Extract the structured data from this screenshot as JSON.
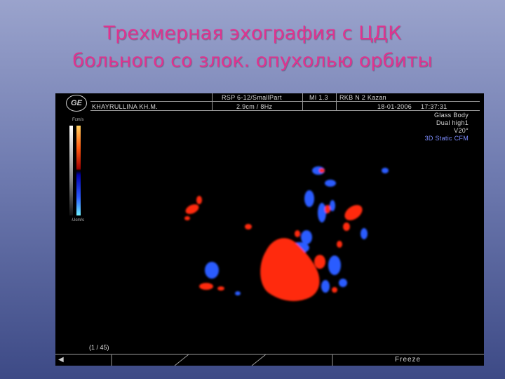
{
  "slide": {
    "title_line1": "Трехмерная эхография с ЦДК",
    "title_line2": "больного со злок. опухолью орбиты",
    "title_color": "#e0338f"
  },
  "scanner": {
    "logo": "GE",
    "patient": "KHAYRULLINA KH.M.",
    "probe": "RSP 6-12/SmallPart",
    "depth": "2.9cm / 8Hz",
    "mi": "MI  1.3",
    "clinic": "RKB N 2 Kazan",
    "date": "18-01-2006",
    "time": "17:37:31",
    "mode1": "Glass Body",
    "mode2": "Dual high1",
    "angle": "V20°",
    "mode3": "3D Static CFM",
    "scale_top": "Fcm/s",
    "scale_bottom": "-Ucm/s",
    "frame": "(1  /  45)",
    "status": "Freeze",
    "mode3_color": "#7d8cff",
    "flow_red": "#ff2a10",
    "flow_blue": "#2a5cff"
  }
}
